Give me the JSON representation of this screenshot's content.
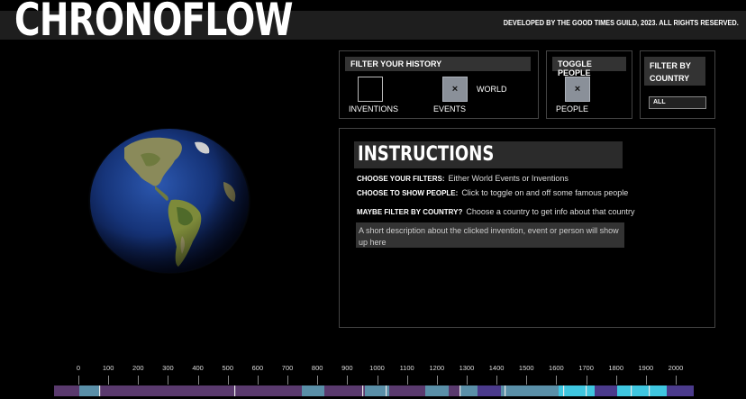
{
  "header": {
    "title": "CHRONOFLOW",
    "credits": "DEVELOPED BY THE GOOD TIMES GUILD, 2023. ALL RIGHTS RESERVED."
  },
  "filters": {
    "header": "FILTER YOUR HISTORY",
    "inventions_label": "INVENTIONS",
    "events_label": "EVENTS",
    "world_label": "WORLD",
    "inventions_checked": false,
    "events_checked": true,
    "check_glyph": "×"
  },
  "people": {
    "header": "TOGGLE PEOPLE",
    "label": "PEOPLE",
    "checked": true,
    "check_glyph": "×"
  },
  "country": {
    "header_line1": "FILTER BY",
    "header_line2": "COUNTRY",
    "selected": "ALL"
  },
  "instructions": {
    "title": "INSTRUCTIONS",
    "line1_label": "CHOOSE YOUR FILTERS:",
    "line1_text": "Either World Events or Inventions",
    "line2_label": "CHOOSE TO SHOW PEOPLE:",
    "line2_text": "Click to toggle on and off some famous people",
    "line3_label": "MAYBE FILTER BY COUNTRY?",
    "line3_text": "Choose a country to get info about that country",
    "description": "A short description about the clicked invention, event or person will show up here"
  },
  "timeline": {
    "ticks": [
      "0",
      "100",
      "200",
      "300",
      "400",
      "500",
      "600",
      "700",
      "800",
      "900",
      "1000",
      "1100",
      "1200",
      "1300",
      "1400",
      "1500",
      "1600",
      "1700",
      "1800",
      "1900",
      "2000"
    ],
    "range": [
      0,
      2050
    ],
    "colors": {
      "purple": "#5a3a6e",
      "teal": "#5a8fa8",
      "cyan": "#3fc6e0",
      "violet": "#4b3b8c"
    }
  }
}
